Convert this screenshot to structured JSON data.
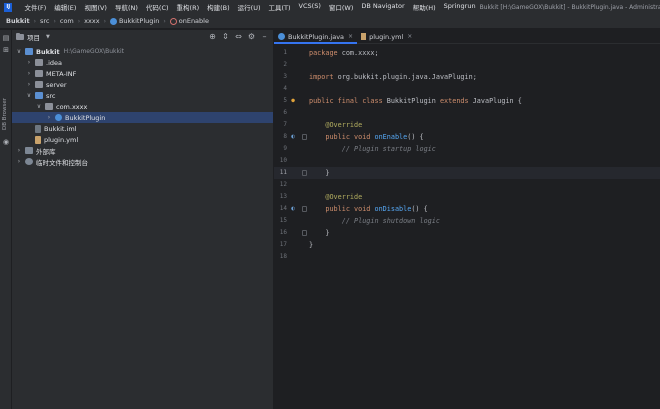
{
  "menubar": {
    "logo": "IJ",
    "items": [
      "文件(F)",
      "编辑(E)",
      "视图(V)",
      "导航(N)",
      "代码(C)",
      "重构(R)",
      "构建(B)",
      "运行(U)",
      "工具(T)",
      "VCS(S)",
      "窗口(W)",
      "DB Navigator",
      "帮助(H)",
      "Springrun"
    ],
    "window_title": "Bukkit [H:\\GameGOX\\Bukkit] - BukkitPlugin.java - Administrator"
  },
  "breadcrumb": {
    "items": [
      "Bukkit",
      "src",
      "com",
      "xxxx",
      "BukkitPlugin",
      "onEnable"
    ]
  },
  "leftstrip": {
    "db_browser_label": "DB Browser"
  },
  "project_panel": {
    "title": "项目",
    "tools": [
      "target-icon",
      "collapse-icon",
      "expand-icon",
      "gear-icon",
      "minimize-icon"
    ],
    "tree": [
      {
        "label": "Bukkit",
        "path": "H:\\GameGOX\\Bukkit",
        "icon": "folder-blue",
        "depth": 0,
        "chevron": "down",
        "bold": true
      },
      {
        "label": ".idea",
        "icon": "folder",
        "depth": 1,
        "chevron": "right"
      },
      {
        "label": "META-INF",
        "icon": "folder",
        "depth": 1,
        "chevron": "right"
      },
      {
        "label": "server",
        "icon": "folder",
        "depth": 1,
        "chevron": "right"
      },
      {
        "label": "src",
        "icon": "folder-blue",
        "depth": 1,
        "chevron": "down"
      },
      {
        "label": "com.xxxx",
        "icon": "pkg",
        "depth": 2,
        "chevron": "down"
      },
      {
        "label": "BukkitPlugin",
        "icon": "class",
        "depth": 3,
        "chevron": "right",
        "selected": true
      },
      {
        "label": "Bukkit.iml",
        "icon": "file-iml",
        "depth": 1,
        "chevron": "none"
      },
      {
        "label": "plugin.yml",
        "icon": "file-yml",
        "depth": 1,
        "chevron": "none"
      },
      {
        "label": "外部库",
        "icon": "lib",
        "depth": 0,
        "chevron": "right"
      },
      {
        "label": "临时文件和控制台",
        "icon": "scratch",
        "depth": 0,
        "chevron": "right"
      }
    ]
  },
  "editor": {
    "tabs": [
      {
        "label": "BukkitPlugin.java",
        "icon": "class",
        "active": true
      },
      {
        "label": "plugin.yml",
        "icon": "yml",
        "active": false
      }
    ],
    "current_line": 11,
    "lines": [
      {
        "n": "1",
        "tokens": [
          [
            "kw",
            "package "
          ],
          [
            "cls",
            "com.xxxx;"
          ]
        ]
      },
      {
        "n": "2",
        "tokens": []
      },
      {
        "n": "3",
        "tokens": [
          [
            "kw",
            "import "
          ],
          [
            "cls",
            "org.bukkit.plugin.java.JavaPlugin;"
          ]
        ]
      },
      {
        "n": "4",
        "tokens": []
      },
      {
        "n": "5",
        "gutter": "run",
        "tokens": [
          [
            "kw",
            "public final class "
          ],
          [
            "cls",
            "BukkitPlugin "
          ],
          [
            "kw",
            "extends "
          ],
          [
            "cls",
            "JavaPlugin {"
          ]
        ]
      },
      {
        "n": "6",
        "tokens": []
      },
      {
        "n": "7",
        "tokens": [
          [
            "ann",
            "    @Override"
          ]
        ]
      },
      {
        "n": "8",
        "gutter": "impl",
        "fold": true,
        "tokens": [
          [
            "kw",
            "    public void "
          ],
          [
            "fn",
            "onEnable"
          ],
          [
            "cls",
            "() {"
          ]
        ]
      },
      {
        "n": "9",
        "tokens": [
          [
            "cmt",
            "        // Plugin startup logic"
          ]
        ]
      },
      {
        "n": "10",
        "tokens": []
      },
      {
        "n": "11",
        "fold": true,
        "tokens": [
          [
            "cls",
            "    }"
          ]
        ]
      },
      {
        "n": "12",
        "tokens": []
      },
      {
        "n": "13",
        "tokens": [
          [
            "ann",
            "    @Override"
          ]
        ]
      },
      {
        "n": "14",
        "gutter": "impl",
        "fold": true,
        "tokens": [
          [
            "kw",
            "    public void "
          ],
          [
            "fn",
            "onDisable"
          ],
          [
            "cls",
            "() {"
          ]
        ]
      },
      {
        "n": "15",
        "tokens": [
          [
            "cmt",
            "        // Plugin shutdown logic"
          ]
        ]
      },
      {
        "n": "16",
        "fold": true,
        "tokens": [
          [
            "cls",
            "    }"
          ]
        ]
      },
      {
        "n": "17",
        "tokens": [
          [
            "cls",
            "}"
          ]
        ]
      },
      {
        "n": "18",
        "tokens": []
      }
    ]
  }
}
